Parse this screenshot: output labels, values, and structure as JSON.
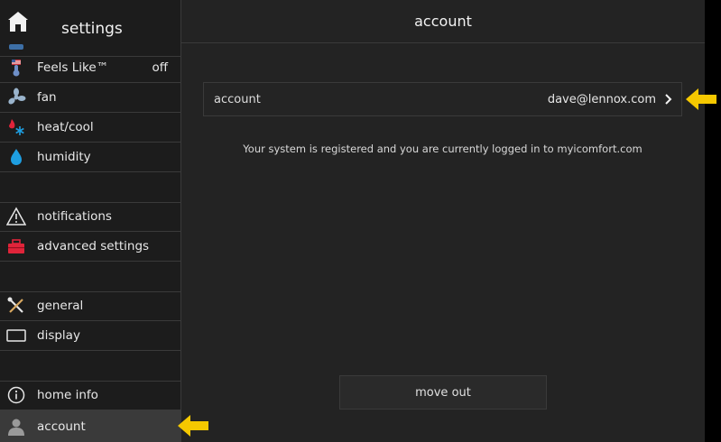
{
  "sidebar": {
    "title": "settings",
    "items": [
      {
        "label": "Feels Like™",
        "value": "off"
      },
      {
        "label": "fan"
      },
      {
        "label": "heat/cool"
      },
      {
        "label": "humidity"
      },
      {
        "label": "notifications"
      },
      {
        "label": "advanced settings"
      },
      {
        "label": "general"
      },
      {
        "label": "display"
      },
      {
        "label": "home info"
      },
      {
        "label": "account"
      }
    ]
  },
  "main": {
    "title": "account",
    "account_row": {
      "label": "account",
      "value": "dave@lennox.com"
    },
    "status_text": "Your system is registered and you are currently logged in to myicomfort.com",
    "move_out_label": "move out"
  },
  "colors": {
    "accent_arrow": "#f5c800",
    "active_bg": "#3a3a3a",
    "alert_red": "#e0243a",
    "water_blue": "#1e9ee0"
  }
}
